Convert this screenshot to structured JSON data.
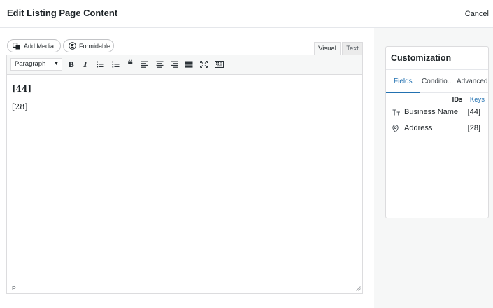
{
  "header": {
    "title": "Edit Listing Page Content",
    "cancel_label": "Cancel"
  },
  "media_buttons": {
    "add_media": "Add Media",
    "formidable": "Formidable"
  },
  "editor_tabs": {
    "visual": "Visual",
    "text": "Text"
  },
  "toolbar": {
    "format_select": "Paragraph"
  },
  "content": {
    "line1": "[44]",
    "line2": "[28]"
  },
  "statusbar": {
    "path": "P"
  },
  "customization": {
    "title": "Customization",
    "tabs": [
      "Fields",
      "Conditio...",
      "Advanced"
    ],
    "ids_label": "IDs",
    "separator": "|",
    "keys_label": "Keys",
    "fields": [
      {
        "icon": "text-field-icon",
        "name": "Business Name",
        "id": "[44]"
      },
      {
        "icon": "location-pin-icon",
        "name": "Address",
        "id": "[28]"
      }
    ]
  },
  "colors": {
    "accent": "#2271b1",
    "border": "#dcdcde",
    "sidebar_bg": "#f6f7f7"
  }
}
